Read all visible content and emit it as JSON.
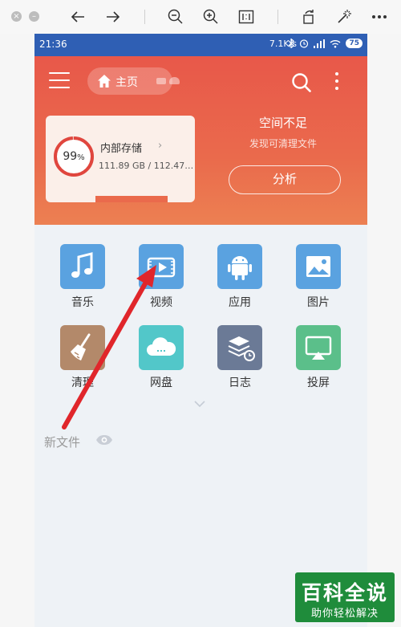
{
  "viewer": {
    "icons": [
      "close-icon",
      "minimize-icon",
      "back-arrow-icon",
      "forward-arrow-icon",
      "zoom-out-icon",
      "zoom-in-icon",
      "actual-size-icon",
      "rotate-icon",
      "magic-wand-icon",
      "more-icon"
    ]
  },
  "status_bar": {
    "time": "21:36",
    "net_speed": "7.1K/s",
    "battery": "75"
  },
  "header": {
    "home_label": "主页",
    "storage": {
      "percent": "99",
      "percent_unit": "%",
      "title": "内部存储",
      "size_text": "111.89 GB / 112.47…",
      "used_fraction": 0.99
    },
    "space_title": "空间不足",
    "space_subtitle": "发现可清理文件",
    "analyze_button": "分析"
  },
  "apps": [
    {
      "label": "音乐",
      "icon": "music-icon",
      "color": "#5aa2e0"
    },
    {
      "label": "视频",
      "icon": "video-icon",
      "color": "#5aa2e0"
    },
    {
      "label": "应用",
      "icon": "android-icon",
      "color": "#5aa2e0"
    },
    {
      "label": "图片",
      "icon": "image-icon",
      "color": "#5aa2e0"
    },
    {
      "label": "清理",
      "icon": "broom-icon",
      "color": "#b3896a"
    },
    {
      "label": "网盘",
      "icon": "cloud-icon",
      "color": "#52c7c9"
    },
    {
      "label": "日志",
      "icon": "log-icon",
      "color": "#6b7a96"
    },
    {
      "label": "投屏",
      "icon": "cast-icon",
      "color": "#5bbf8a"
    }
  ],
  "new_files": {
    "title": "新文件"
  },
  "colors": {
    "status_bar": "#2f5fb4",
    "header_top": "#e8584a",
    "header_bottom": "#ec8052",
    "annotation_arrow": "#e0262b",
    "watermark": "#1f8c3b"
  },
  "watermark": {
    "line1": "百科全说",
    "line2": "助你轻松解决"
  }
}
